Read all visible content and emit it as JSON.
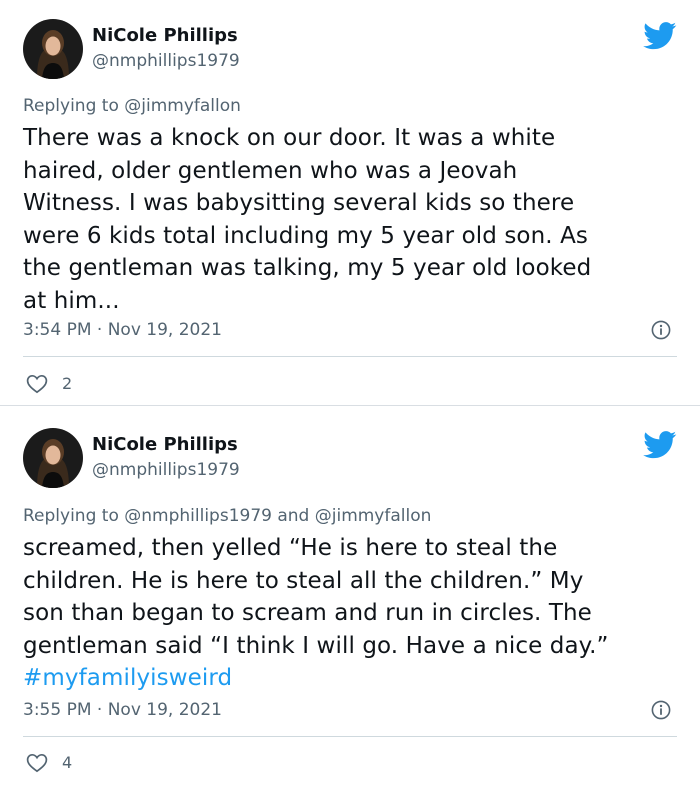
{
  "tweets": [
    {
      "author_name": "NiCole Phillips",
      "author_handle": "@nmphillips1979",
      "reply_prefix": "Replying to ",
      "reply_to": "@jimmyfallon",
      "body_lines": [
        "There was a knock on our door. It was a white",
        "haired, older gentlemen who was a Jeovah",
        "Witness. I was babysitting several kids so there",
        "were 6 kids total including my 5 year old son. As",
        "the gentleman was talking, my 5 year old looked",
        "at him..."
      ],
      "timestamp": "3:54 PM · Nov 19, 2021",
      "like_count": "2"
    },
    {
      "author_name": "NiCole Phillips",
      "author_handle": "@nmphillips1979",
      "reply_prefix": "Replying to ",
      "reply_to": "@nmphillips1979 and @jimmyfallon",
      "body_lines": [
        "screamed, then yelled “He is here to steal the",
        "children. He is here to steal all the children.” My",
        "son than began to scream and run in circles. The",
        "gentleman said “I think I will go. Have a nice day.”"
      ],
      "hashtag": "#myfamilyisweird",
      "timestamp": "3:55 PM · Nov 19, 2021",
      "like_count": "4"
    }
  ],
  "colors": {
    "text": "#0f1419",
    "secondary": "#536471",
    "accent": "#1d9bf0"
  },
  "icons": [
    "twitter-bird-icon",
    "info-icon",
    "heart-icon"
  ]
}
